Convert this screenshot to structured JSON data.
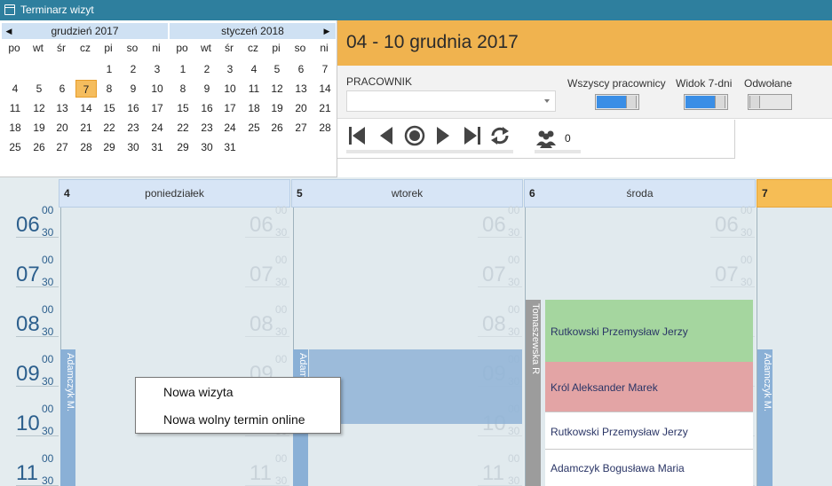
{
  "window": {
    "title": "Terminarz wizyt",
    "icon": "calendar-icon"
  },
  "calendars": [
    {
      "name": "grudzień 2017",
      "weekdays": [
        "po",
        "wt",
        "śr",
        "cz",
        "pi",
        "so",
        "ni"
      ],
      "weeks": [
        [
          "",
          "",
          "",
          "",
          "1",
          "2",
          "3"
        ],
        [
          "4",
          "5",
          "6",
          "7",
          "8",
          "9",
          "10"
        ],
        [
          "11",
          "12",
          "13",
          "14",
          "15",
          "16",
          "17"
        ],
        [
          "18",
          "19",
          "20",
          "21",
          "22",
          "23",
          "24"
        ],
        [
          "25",
          "26",
          "27",
          "28",
          "29",
          "30",
          "31"
        ]
      ],
      "today": "7"
    },
    {
      "name": "styczeń 2018",
      "weekdays": [
        "po",
        "wt",
        "śr",
        "cz",
        "pi",
        "so",
        "ni"
      ],
      "weeks": [
        [
          "1",
          "2",
          "3",
          "4",
          "5",
          "6",
          "7"
        ],
        [
          "8",
          "9",
          "10",
          "11",
          "12",
          "13",
          "14"
        ],
        [
          "15",
          "16",
          "17",
          "18",
          "19",
          "20",
          "21"
        ],
        [
          "22",
          "23",
          "24",
          "25",
          "26",
          "27",
          "28"
        ],
        [
          "29",
          "30",
          "31",
          "",
          "",
          "",
          ""
        ]
      ]
    }
  ],
  "header": {
    "range": "04 - 10 grudnia 2017"
  },
  "filters": {
    "staff_label": "PRACOWNIK",
    "staff_value": "",
    "toggles": [
      {
        "label": "Wszyscy pracownicy",
        "on": true
      },
      {
        "label": "Widok 7-dni",
        "on": true
      },
      {
        "label": "Odwołane",
        "on": false
      }
    ]
  },
  "navigation": {
    "buttons": [
      "first-icon",
      "prev-icon",
      "today-icon",
      "next-icon",
      "last-icon",
      "refresh-icon"
    ],
    "people_icon": "people-icon",
    "count": "0"
  },
  "scheduler": {
    "days": [
      {
        "num": "4",
        "name": "poniedziałek"
      },
      {
        "num": "5",
        "name": "wtorek"
      },
      {
        "num": "6",
        "name": "środa"
      },
      {
        "num": "7",
        "name": ""
      }
    ],
    "hours": [
      "06",
      "07",
      "08",
      "09",
      "10",
      "11"
    ],
    "mins_top": "00",
    "mins_bottom": "30",
    "staff": [
      "Adamczyk M.",
      "Adamczyk M.",
      "Tomaszewska R",
      "Adamczyk M."
    ],
    "appointments": [
      {
        "name": "Rutkowski Przemysław Jerzy",
        "color": "#a5d69f"
      },
      {
        "name": "Król Aleksander Marek",
        "color": "#e3a4a5"
      },
      {
        "name": "Rutkowski Przemysław Jerzy",
        "color": "#ffffff"
      },
      {
        "name": "Adamczyk Bogusława Maria",
        "color": "#ffffff"
      }
    ]
  },
  "context_menu": {
    "items": [
      "Nowa wizyta",
      "Nowa wolny termin online"
    ]
  },
  "colors": {
    "titlebar": "#2e7f9e",
    "accent": "#f0b34f",
    "toggle_on": "#3a8ee6",
    "staff_bar": "#8ab0d6"
  }
}
